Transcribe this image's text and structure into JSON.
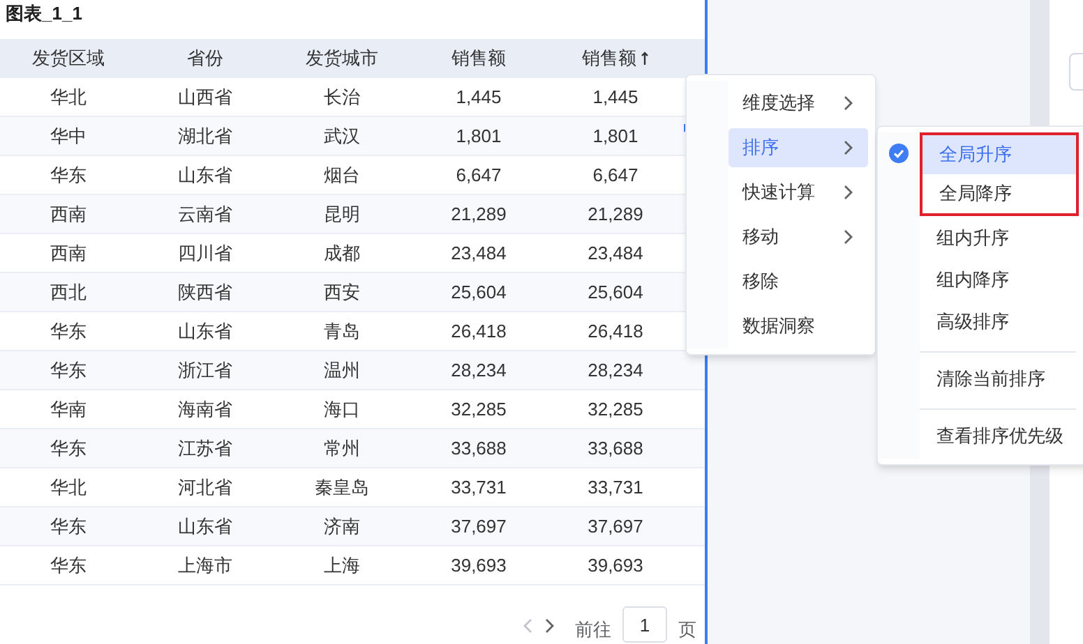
{
  "title": "图表_1_1",
  "table": {
    "columns": [
      {
        "label": "发货区域",
        "sorted": false
      },
      {
        "label": "省份",
        "sorted": false
      },
      {
        "label": "发货城市",
        "sorted": false
      },
      {
        "label": "销售额",
        "sorted": false
      },
      {
        "label": "销售额",
        "sorted": true
      }
    ],
    "rows": [
      [
        "华北",
        "山西省",
        "长治",
        "1,445",
        "1,445"
      ],
      [
        "华中",
        "湖北省",
        "武汉",
        "1,801",
        "1,801"
      ],
      [
        "华东",
        "山东省",
        "烟台",
        "6,647",
        "6,647"
      ],
      [
        "西南",
        "云南省",
        "昆明",
        "21,289",
        "21,289"
      ],
      [
        "西南",
        "四川省",
        "成都",
        "23,484",
        "23,484"
      ],
      [
        "西北",
        "陕西省",
        "西安",
        "25,604",
        "25,604"
      ],
      [
        "华东",
        "山东省",
        "青岛",
        "26,418",
        "26,418"
      ],
      [
        "华东",
        "浙江省",
        "温州",
        "28,234",
        "28,234"
      ],
      [
        "华南",
        "海南省",
        "海口",
        "32,285",
        "32,285"
      ],
      [
        "华东",
        "江苏省",
        "常州",
        "33,688",
        "33,688"
      ],
      [
        "华北",
        "河北省",
        "秦皇岛",
        "33,731",
        "33,731"
      ],
      [
        "华东",
        "山东省",
        "济南",
        "37,697",
        "37,697"
      ],
      [
        "华东",
        "上海市",
        "上海",
        "39,693",
        "39,693"
      ]
    ]
  },
  "pagination": {
    "prev_disabled": true,
    "next_disabled": false,
    "goto_label": "前往",
    "page": "1",
    "page_suffix": "页"
  },
  "context_menu": {
    "items": [
      {
        "label": "维度选择",
        "has_submenu": true,
        "selected": false
      },
      {
        "label": "排序",
        "has_submenu": true,
        "selected": true
      },
      {
        "label": "快速计算",
        "has_submenu": true,
        "selected": false
      },
      {
        "label": "移动",
        "has_submenu": true,
        "selected": false
      },
      {
        "label": "移除",
        "has_submenu": false,
        "selected": false
      },
      {
        "label": "数据洞察",
        "has_submenu": false,
        "selected": false
      }
    ]
  },
  "sort_submenu": {
    "groups": [
      {
        "outlined": true,
        "divider_before": false,
        "items": [
          {
            "label": "全局升序",
            "selected": true
          },
          {
            "label": "全局降序",
            "selected": false
          }
        ]
      },
      {
        "outlined": false,
        "divider_before": false,
        "items": [
          {
            "label": "组内升序",
            "selected": false
          },
          {
            "label": "组内降序",
            "selected": false
          },
          {
            "label": "高级排序",
            "selected": false
          }
        ]
      },
      {
        "outlined": false,
        "divider_before": true,
        "items": [
          {
            "label": "清除当前排序",
            "selected": false
          }
        ]
      },
      {
        "outlined": false,
        "divider_before": true,
        "items": [
          {
            "label": "查看排序优先级",
            "selected": false
          }
        ]
      }
    ]
  }
}
